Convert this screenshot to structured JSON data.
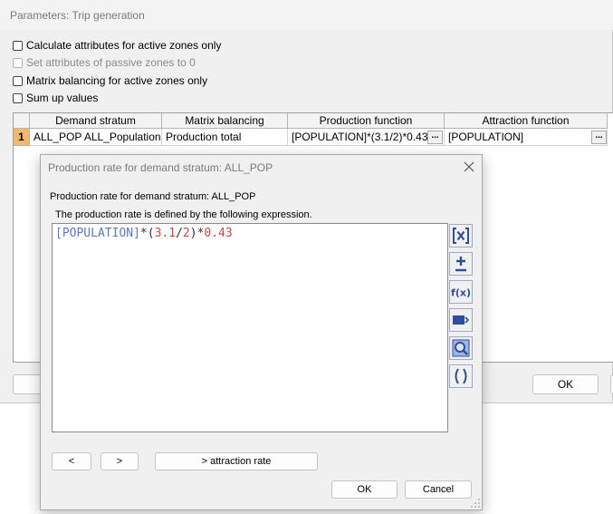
{
  "main_window": {
    "title": "Parameters: Trip generation",
    "options": [
      {
        "label": "Calculate attributes for active zones only",
        "checked": false,
        "enabled": true
      },
      {
        "label": "Set attributes of passive zones to 0",
        "checked": false,
        "enabled": false
      },
      {
        "label": "Matrix balancing for active zones only",
        "checked": false,
        "enabled": true
      },
      {
        "label": "Sum up values",
        "checked": false,
        "enabled": true
      }
    ],
    "grid": {
      "columns": [
        "Demand stratum",
        "Matrix balancing",
        "Production function",
        "Attraction function"
      ],
      "rows": [
        {
          "num": "1",
          "cells": [
            "ALL_POP ALL_Population",
            "Production total",
            "[POPULATION]*(3.1/2)*0.43",
            "[POPULATION]"
          ]
        }
      ],
      "ellipsis_label": "..."
    },
    "ok_label": "OK"
  },
  "dialog": {
    "title": "Production rate for demand stratum: ALL_POP",
    "heading": "Production rate for demand stratum: ALL_POP",
    "description": "The production rate is defined by the following expression.",
    "expression": {
      "attr": "[POPULATION]",
      "op1": "*(",
      "num1": "3.1",
      "op2": "/",
      "num2": "2",
      "op3": ")*",
      "num3": "0.43"
    },
    "toolbar": [
      {
        "name": "insert-attribute-icon"
      },
      {
        "name": "insert-operator-icon"
      },
      {
        "name": "insert-function-icon"
      },
      {
        "name": "insert-value-icon"
      },
      {
        "name": "zoom-icon"
      },
      {
        "name": "brackets-icon"
      }
    ],
    "nav": {
      "prev": "<",
      "next": ">",
      "attraction": "> attraction rate"
    },
    "ok_label": "OK",
    "cancel_label": "Cancel"
  },
  "colors": {
    "attribute_token": "#5a78d6",
    "number_token": "#d04a3c",
    "row_highlight": "#f5b86a",
    "toolbar_icon": "#2f4f9e"
  }
}
